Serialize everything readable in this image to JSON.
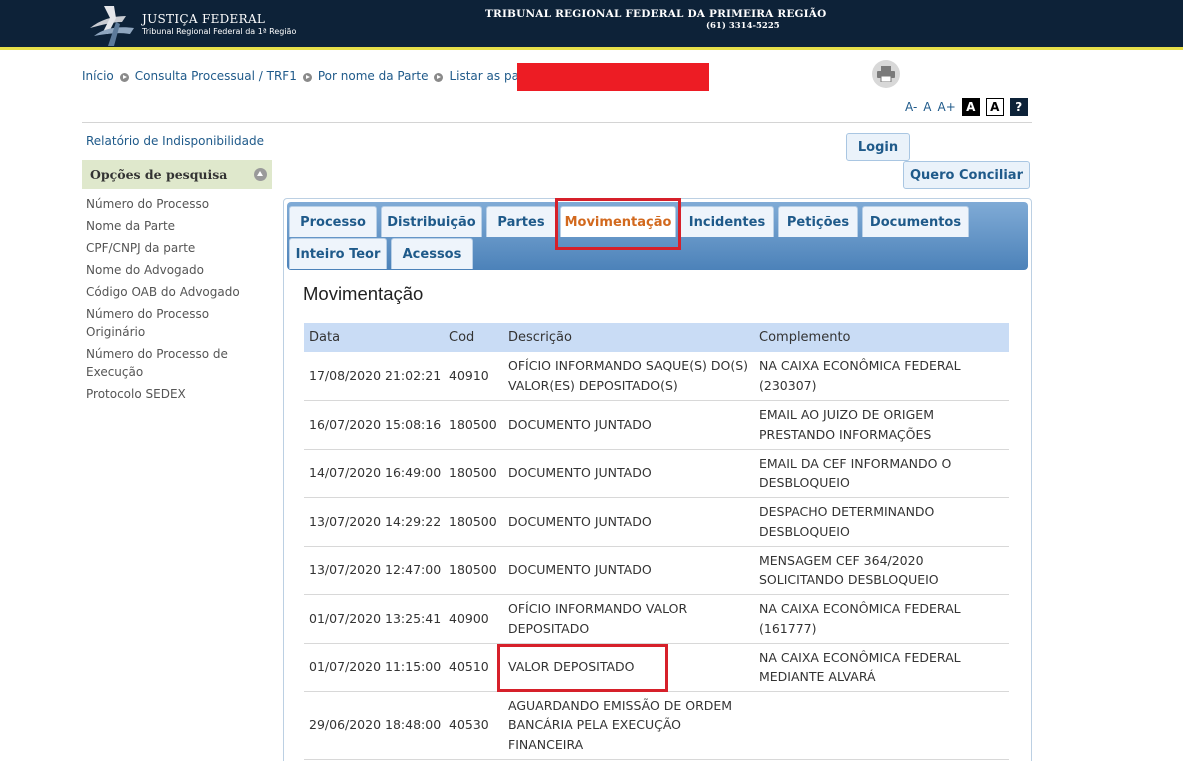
{
  "header": {
    "logo_title": "JUSTIÇA FEDERAL",
    "logo_subtitle": "Tribunal Regional Federal da 1ª Região",
    "court_name": "TRIBUNAL REGIONAL FEDERAL DA PRIMEIRA REGIÃO",
    "court_phone": "(61) 3314-5225",
    "colors": {
      "background": "#0d2238",
      "accent_line": "#e7e04a"
    }
  },
  "breadcrumb": [
    "Início",
    "Consulta Processual / TRF1",
    "Por nome da Parte",
    "Listar as partes"
  ],
  "font_tools": {
    "decrease": "A-",
    "normal": "A",
    "increase": "A+",
    "contrast_dark": "A",
    "contrast_light": "A",
    "help": "?"
  },
  "sidebar": {
    "report_link": "Relatório de Indisponibilidade",
    "search_title": "Opções de pesquisa",
    "search_options": [
      "Número do Processo",
      "Nome da Parte",
      "CPF/CNPJ da parte",
      "Nome do Advogado",
      "Código OAB do Advogado",
      "Número do Processo Originário",
      "Número do Processo de Execução",
      "Protocolo SEDEX"
    ]
  },
  "buttons": {
    "login": "Login",
    "conciliar": "Quero Conciliar"
  },
  "tabs": [
    {
      "label": "Processo",
      "active": false
    },
    {
      "label": "Distribuição",
      "active": false
    },
    {
      "label": "Partes",
      "active": false
    },
    {
      "label": "Movimentação",
      "active": true
    },
    {
      "label": "Incidentes",
      "active": false
    },
    {
      "label": "Petições",
      "active": false
    },
    {
      "label": "Documentos",
      "active": false
    },
    {
      "label": "Inteiro Teor",
      "active": false
    },
    {
      "label": "Acessos",
      "active": false
    }
  ],
  "main": {
    "title": "Movimentação",
    "columns": [
      "Data",
      "Cod",
      "Descrição",
      "Complemento"
    ],
    "rows": [
      {
        "data": "17/08/2020 21:02:21",
        "cod": "40910",
        "descricao": "OFÍCIO INFORMANDO SAQUE(S) DO(S) VALOR(ES) DEPOSITADO(S)",
        "complemento": "NA CAIXA ECONÔMICA FEDERAL (230307)"
      },
      {
        "data": "16/07/2020 15:08:16",
        "cod": "180500",
        "descricao": "DOCUMENTO JUNTADO",
        "complemento": "EMAIL AO JUIZO DE ORIGEM PRESTANDO INFORMAÇÕES"
      },
      {
        "data": "14/07/2020 16:49:00",
        "cod": "180500",
        "descricao": "DOCUMENTO JUNTADO",
        "complemento": "EMAIL DA CEF INFORMANDO O DESBLOQUEIO"
      },
      {
        "data": "13/07/2020 14:29:22",
        "cod": "180500",
        "descricao": "DOCUMENTO JUNTADO",
        "complemento": "DESPACHO DETERMINANDO DESBLOQUEIO"
      },
      {
        "data": "13/07/2020 12:47:00",
        "cod": "180500",
        "descricao": "DOCUMENTO JUNTADO",
        "complemento": "MENSAGEM CEF 364/2020 SOLICITANDO DESBLOQUEIO"
      },
      {
        "data": "01/07/2020 13:25:41",
        "cod": "40900",
        "descricao": "OFÍCIO INFORMANDO VALOR DEPOSITADO",
        "complemento": "NA CAIXA ECONÔMICA FEDERAL (161777)"
      },
      {
        "data": "01/07/2020 11:15:00",
        "cod": "40510",
        "descricao": "VALOR DEPOSITADO",
        "complemento": "NA CAIXA ECONÔMICA FEDERAL MEDIANTE ALVARÁ"
      },
      {
        "data": "29/06/2020 18:48:00",
        "cod": "40530",
        "descricao": "AGUARDANDO EMISSÃO DE ORDEM BANCÁRIA PELA EXECUÇÃO FINANCEIRA",
        "complemento": ""
      }
    ]
  }
}
